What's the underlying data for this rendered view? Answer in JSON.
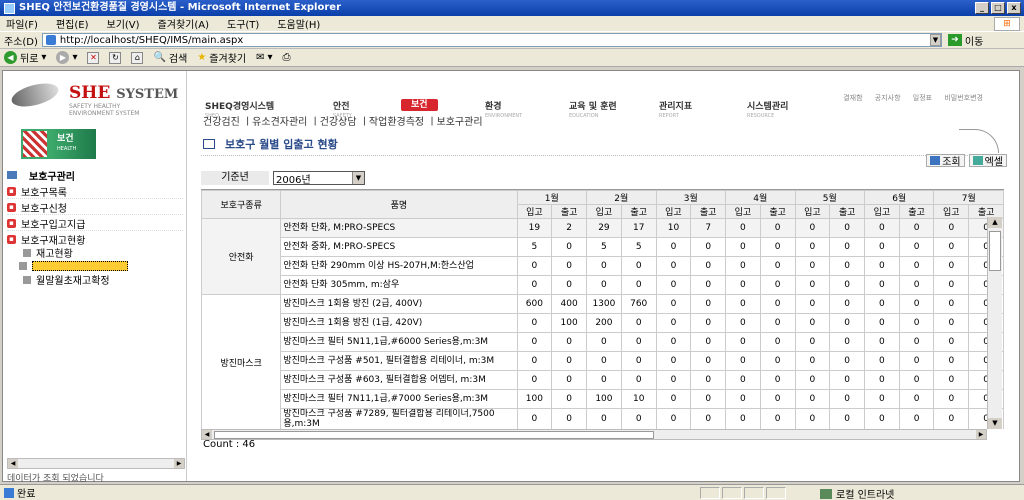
{
  "window": {
    "title": "SHEQ 안전보건환경품질 경영시스템 - Microsoft Internet Explorer",
    "buttons": [
      "_",
      "□",
      "x"
    ]
  },
  "menu": [
    "파일(F)",
    "편집(E)",
    "보기(V)",
    "즐겨찾기(A)",
    "도구(T)",
    "도움말(H)"
  ],
  "address": {
    "label": "주소(D)",
    "url": "http://localhost/SHEQ/IMS/main.aspx",
    "go": "이동"
  },
  "toolbar": {
    "back": "뒤로",
    "search": "검색",
    "favorites": "즐겨찾기"
  },
  "logo": {
    "main": "SHE",
    "system": "SYSTEM",
    "sub1": "SAFETY HEALTHY",
    "sub2": "ENVIRONMENT SYSTEM"
  },
  "banner": {
    "title": "보건",
    "sub": "HEALTH"
  },
  "left_nav": {
    "header": "보호구관리",
    "items": [
      "보호구목록",
      "보호구신청",
      "보호구입고지급",
      "보호구재고현황"
    ],
    "sub_items": [
      "재고현황",
      "월말월초재고확정"
    ],
    "status": "데이터가 조회 되었습니다"
  },
  "util_links": [
    "결재함",
    "공지사항",
    "일정표",
    "비밀번호변경"
  ],
  "top_nav": [
    {
      "label": "SHEQ경영시스템",
      "sub": "SHEQ"
    },
    {
      "label": "안전",
      "sub": "SAFETY"
    },
    {
      "label": "보건",
      "sub": ""
    },
    {
      "label": "환경",
      "sub": "ENVIRONMENT"
    },
    {
      "label": "교육 및 훈련",
      "sub": "EDUCATION"
    },
    {
      "label": "관리지표",
      "sub": "REPORT"
    },
    {
      "label": "시스템관리",
      "sub": "RESOURCE"
    }
  ],
  "sub_nav": "건강검진 ㅣ유소견자관리 ㅣ건강상담 ㅣ작업환경측정 ㅣ보호구관리",
  "page_title": "보호구 월별 입출고 현황",
  "actions": {
    "search": "조회",
    "excel": "엑셀"
  },
  "filter": {
    "label": "기준년",
    "value": "2006년"
  },
  "table": {
    "h_type": "보호구종류",
    "h_name": "품명",
    "months": [
      "1월",
      "2월",
      "3월",
      "4월",
      "5월",
      "6월",
      "7월"
    ],
    "in": "입고",
    "out": "출고",
    "groups": [
      {
        "type": "안전화",
        "rows": [
          {
            "name": "안전화 단화, M:PRO-SPECS",
            "vals": [
              "19",
              "2",
              "29",
              "17",
              "10",
              "7",
              "0",
              "0",
              "0",
              "0",
              "0",
              "0",
              "0",
              "0"
            ]
          },
          {
            "name": "안전화 중화, M:PRO-SPECS",
            "vals": [
              "5",
              "0",
              "5",
              "5",
              "0",
              "0",
              "0",
              "0",
              "0",
              "0",
              "0",
              "0",
              "0",
              "0"
            ]
          },
          {
            "name": "안전화 단화 290mm 이상 HS-207H,M:한스산업",
            "vals": [
              "0",
              "0",
              "0",
              "0",
              "0",
              "0",
              "0",
              "0",
              "0",
              "0",
              "0",
              "0",
              "0",
              "0"
            ]
          },
          {
            "name": "안전화 단화 305mm, m:삼우",
            "vals": [
              "0",
              "0",
              "0",
              "0",
              "0",
              "0",
              "0",
              "0",
              "0",
              "0",
              "0",
              "0",
              "0",
              "0"
            ]
          }
        ]
      },
      {
        "type": "방진마스크",
        "rows": [
          {
            "name": "방진마스크 1회용 방진 (2급, 400V)",
            "vals": [
              "600",
              "400",
              "1300",
              "760",
              "0",
              "0",
              "0",
              "0",
              "0",
              "0",
              "0",
              "0",
              "0",
              "0"
            ]
          },
          {
            "name": "방진마스크 1회용 방진 (1급, 420V)",
            "vals": [
              "0",
              "100",
              "200",
              "0",
              "0",
              "0",
              "0",
              "0",
              "0",
              "0",
              "0",
              "0",
              "0",
              "0"
            ]
          },
          {
            "name": "방진마스크 필터 5N11,1급,#6000 Series용,m:3M",
            "vals": [
              "0",
              "0",
              "0",
              "0",
              "0",
              "0",
              "0",
              "0",
              "0",
              "0",
              "0",
              "0",
              "0",
              "0"
            ]
          },
          {
            "name": "방진마스크 구성품 #501, 필터결합용 리테이너, m:3M",
            "vals": [
              "0",
              "0",
              "0",
              "0",
              "0",
              "0",
              "0",
              "0",
              "0",
              "0",
              "0",
              "0",
              "0",
              "0"
            ]
          },
          {
            "name": "방진마스크 구성품 #603, 필터결합용 어뎁터, m:3M",
            "vals": [
              "0",
              "0",
              "0",
              "0",
              "0",
              "0",
              "0",
              "0",
              "0",
              "0",
              "0",
              "0",
              "0",
              "0"
            ]
          },
          {
            "name": "방진마스크 필터 7N11,1급,#7000 Series용,m:3M",
            "vals": [
              "100",
              "0",
              "100",
              "10",
              "0",
              "0",
              "0",
              "0",
              "0",
              "0",
              "0",
              "0",
              "0",
              "0"
            ]
          },
          {
            "name": "방진마스크 구성품 #7289, 필터결합용 리테이너,7500용,m:3M",
            "vals": [
              "0",
              "0",
              "0",
              "0",
              "0",
              "0",
              "0",
              "0",
              "0",
              "0",
              "0",
              "0",
              "0",
              "0"
            ]
          }
        ]
      }
    ]
  },
  "count": "Count : 46",
  "status": {
    "text": "완료",
    "zone": "로컬 인트라넷"
  }
}
